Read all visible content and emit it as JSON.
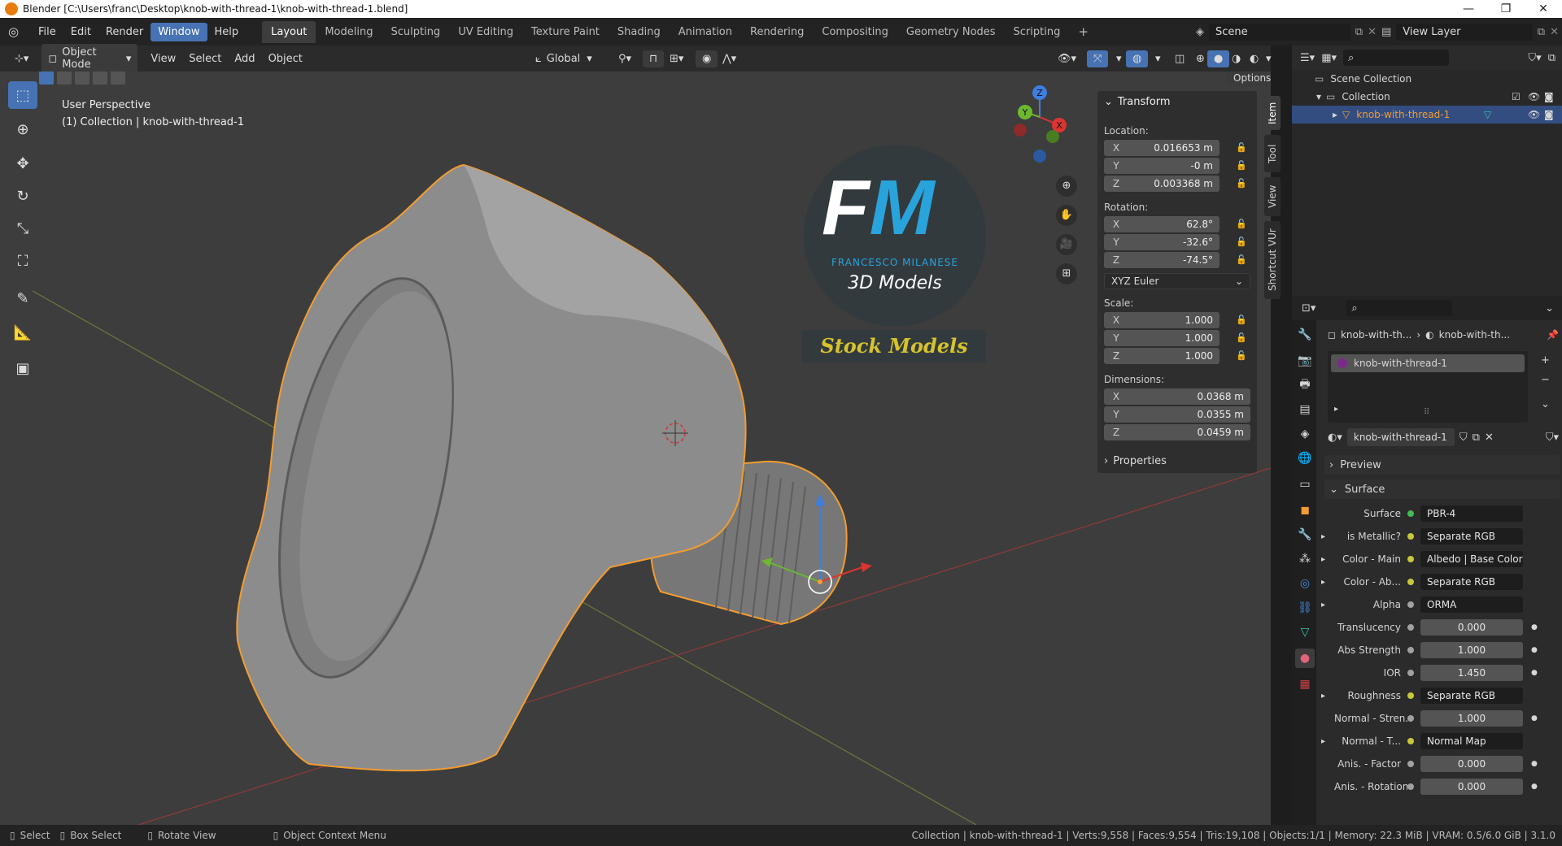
{
  "window": {
    "title": "Blender [C:\\Users\\franc\\Desktop\\knob-with-thread-1\\knob-with-thread-1.blend]"
  },
  "menus": [
    "File",
    "Edit",
    "Render",
    "Window",
    "Help"
  ],
  "workspaces": [
    "Layout",
    "Modeling",
    "Sculpting",
    "UV Editing",
    "Texture Paint",
    "Shading",
    "Animation",
    "Rendering",
    "Compositing",
    "Geometry Nodes",
    "Scripting"
  ],
  "scene": {
    "label": "Scene",
    "view_layer": "View Layer"
  },
  "viewport_header": {
    "mode": "Object Mode",
    "menus": [
      "View",
      "Select",
      "Add",
      "Object"
    ],
    "orientation": "Global",
    "options": "Options"
  },
  "viewport": {
    "perspective": "User Perspective",
    "collection_info": "(1) Collection | knob-with-thread-1",
    "logo": {
      "initials_f": "F",
      "initials_m": "M",
      "name": "FRANCESCO MILANESE",
      "tagline": "3D Models",
      "banner": "Stock Models"
    },
    "gizmo": {
      "z": "Z",
      "y": "Y",
      "x": "X"
    }
  },
  "npanel": {
    "header": "Transform",
    "location_label": "Location:",
    "location": [
      {
        "axis": "X",
        "value": "0.016653 m"
      },
      {
        "axis": "Y",
        "value": "-0 m"
      },
      {
        "axis": "Z",
        "value": "0.003368 m"
      }
    ],
    "rotation_label": "Rotation:",
    "rotation": [
      {
        "axis": "X",
        "value": "62.8°"
      },
      {
        "axis": "Y",
        "value": "-32.6°"
      },
      {
        "axis": "Z",
        "value": "-74.5°"
      }
    ],
    "rotation_mode": "XYZ Euler",
    "scale_label": "Scale:",
    "scale": [
      {
        "axis": "X",
        "value": "1.000"
      },
      {
        "axis": "Y",
        "value": "1.000"
      },
      {
        "axis": "Z",
        "value": "1.000"
      }
    ],
    "dimensions_label": "Dimensions:",
    "dimensions": [
      {
        "axis": "X",
        "value": "0.0368 m"
      },
      {
        "axis": "Y",
        "value": "0.0355 m"
      },
      {
        "axis": "Z",
        "value": "0.0459 m"
      }
    ],
    "properties": "Properties",
    "tabs": [
      "Item",
      "Tool",
      "View",
      "Shortcut VUr"
    ]
  },
  "outliner": {
    "scene_collection": "Scene Collection",
    "collection": "Collection",
    "object": "knob-with-thread-1"
  },
  "properties": {
    "breadcrumb_object": "knob-with-th...",
    "breadcrumb_material": "knob-with-th...",
    "slot": "knob-with-thread-1",
    "material_name": "knob-with-thread-1",
    "preview": "Preview",
    "surface_header": "Surface",
    "rows": [
      {
        "label": "Surface",
        "value": "PBR-4",
        "type": "link",
        "dot": "#44bb55",
        "arrow": false
      },
      {
        "label": "is Metallic?",
        "value": "Separate RGB",
        "type": "link",
        "dot": "#c8c83a",
        "arrow": true
      },
      {
        "label": "Color - Main",
        "value": "Albedo | Base Color",
        "type": "link",
        "dot": "#c8c83a",
        "arrow": true
      },
      {
        "label": "Color - Ab...",
        "value": "Separate RGB",
        "type": "link",
        "dot": "#c8c83a",
        "arrow": true
      },
      {
        "label": "Alpha",
        "value": "ORMA",
        "type": "link",
        "dot": "#a1a1a1",
        "arrow": true
      },
      {
        "label": "Translucency",
        "value": "0.000",
        "type": "num",
        "dot": "#a1a1a1",
        "arrow": false
      },
      {
        "label": "Abs Strength",
        "value": "1.000",
        "type": "num",
        "dot": "#a1a1a1",
        "arrow": false
      },
      {
        "label": "IOR",
        "value": "1.450",
        "type": "num",
        "dot": "#a1a1a1",
        "arrow": false
      },
      {
        "label": "Roughness",
        "value": "Separate RGB",
        "type": "link",
        "dot": "#c8c83a",
        "arrow": true
      },
      {
        "label": "Normal - Stren...",
        "value": "1.000",
        "type": "num",
        "dot": "#a1a1a1",
        "arrow": false
      },
      {
        "label": "Normal - T...",
        "value": "Normal Map",
        "type": "link",
        "dot": "#c8c83a",
        "arrow": true
      },
      {
        "label": "Anis. - Factor",
        "value": "0.000",
        "type": "num",
        "dot": "#a1a1a1",
        "arrow": false
      },
      {
        "label": "Anis. - Rotation",
        "value": "0.000",
        "type": "num",
        "dot": "#a1a1a1",
        "arrow": false
      }
    ]
  },
  "statusbar": {
    "select": "Select",
    "box_select": "Box Select",
    "rotate": "Rotate View",
    "context": "Object Context Menu",
    "info": "Collection | knob-with-thread-1 | Verts:9,558 | Faces:9,554 | Tris:19,108 | Objects:1/1 | Memory: 22.3 MiB | VRAM: 0.5/6.0 GiB | 3.1.0"
  },
  "colors": {
    "accent": "#4772b3",
    "selection": "#f39c31",
    "brand_blue": "#29a3dc",
    "banner_text": "#d6c32c"
  }
}
